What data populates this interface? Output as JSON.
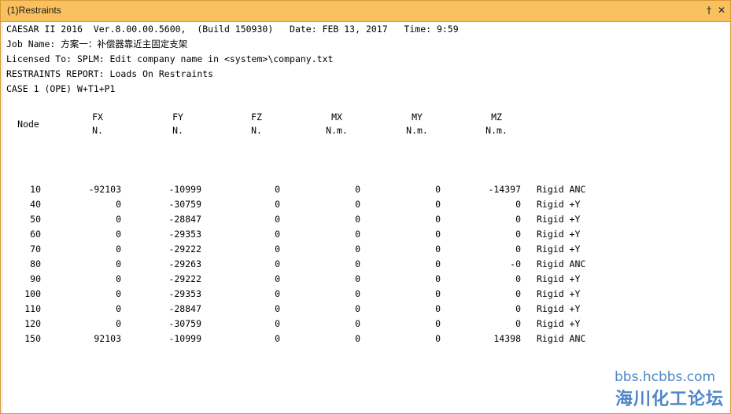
{
  "window": {
    "title": "(1)Restraints",
    "pin_icon": "†",
    "close_icon": "✕"
  },
  "header_lines": [
    "CAESAR II 2016  Ver.8.00.00.5600,  (Build 150930)   Date: FEB 13, 2017   Time: 9:59",
    "Job Name: 方案一：补偿器靠近主固定支架",
    "Licensed To: SPLM: Edit company name in <system>\\company.txt",
    "RESTRAINTS REPORT: Loads On Restraints",
    "CASE 1 (OPE) W+T1+P1"
  ],
  "table": {
    "node_header": "Node",
    "columns": [
      {
        "name": "FX",
        "unit": "N."
      },
      {
        "name": "FY",
        "unit": "N."
      },
      {
        "name": "FZ",
        "unit": "N."
      },
      {
        "name": "MX",
        "unit": "N.m."
      },
      {
        "name": "MY",
        "unit": "N.m."
      },
      {
        "name": "MZ",
        "unit": "N.m."
      }
    ],
    "rows": [
      {
        "node": "10",
        "fx": "-92103",
        "fy": "-10999",
        "fz": "0",
        "mx": "0",
        "my": "0",
        "mz": "-14397",
        "type": "Rigid ANC"
      },
      {
        "node": "40",
        "fx": "0",
        "fy": "-30759",
        "fz": "0",
        "mx": "0",
        "my": "0",
        "mz": "0",
        "type": "Rigid +Y"
      },
      {
        "node": "50",
        "fx": "0",
        "fy": "-28847",
        "fz": "0",
        "mx": "0",
        "my": "0",
        "mz": "0",
        "type": "Rigid +Y"
      },
      {
        "node": "60",
        "fx": "0",
        "fy": "-29353",
        "fz": "0",
        "mx": "0",
        "my": "0",
        "mz": "0",
        "type": "Rigid +Y"
      },
      {
        "node": "70",
        "fx": "0",
        "fy": "-29222",
        "fz": "0",
        "mx": "0",
        "my": "0",
        "mz": "0",
        "type": "Rigid +Y"
      },
      {
        "node": "80",
        "fx": "0",
        "fy": "-29263",
        "fz": "0",
        "mx": "0",
        "my": "0",
        "mz": "-0",
        "type": "Rigid ANC"
      },
      {
        "node": "90",
        "fx": "0",
        "fy": "-29222",
        "fz": "0",
        "mx": "0",
        "my": "0",
        "mz": "0",
        "type": "Rigid +Y"
      },
      {
        "node": "100",
        "fx": "0",
        "fy": "-29353",
        "fz": "0",
        "mx": "0",
        "my": "0",
        "mz": "0",
        "type": "Rigid +Y"
      },
      {
        "node": "110",
        "fx": "0",
        "fy": "-28847",
        "fz": "0",
        "mx": "0",
        "my": "0",
        "mz": "0",
        "type": "Rigid +Y"
      },
      {
        "node": "120",
        "fx": "0",
        "fy": "-30759",
        "fz": "0",
        "mx": "0",
        "my": "0",
        "mz": "0",
        "type": "Rigid +Y"
      },
      {
        "node": "150",
        "fx": "92103",
        "fy": "-10999",
        "fz": "0",
        "mx": "0",
        "my": "0",
        "mz": "14398",
        "type": "Rigid ANC"
      }
    ]
  },
  "watermark": {
    "line1": "bbs.hcbbs.com",
    "line2": "海川化工论坛"
  }
}
